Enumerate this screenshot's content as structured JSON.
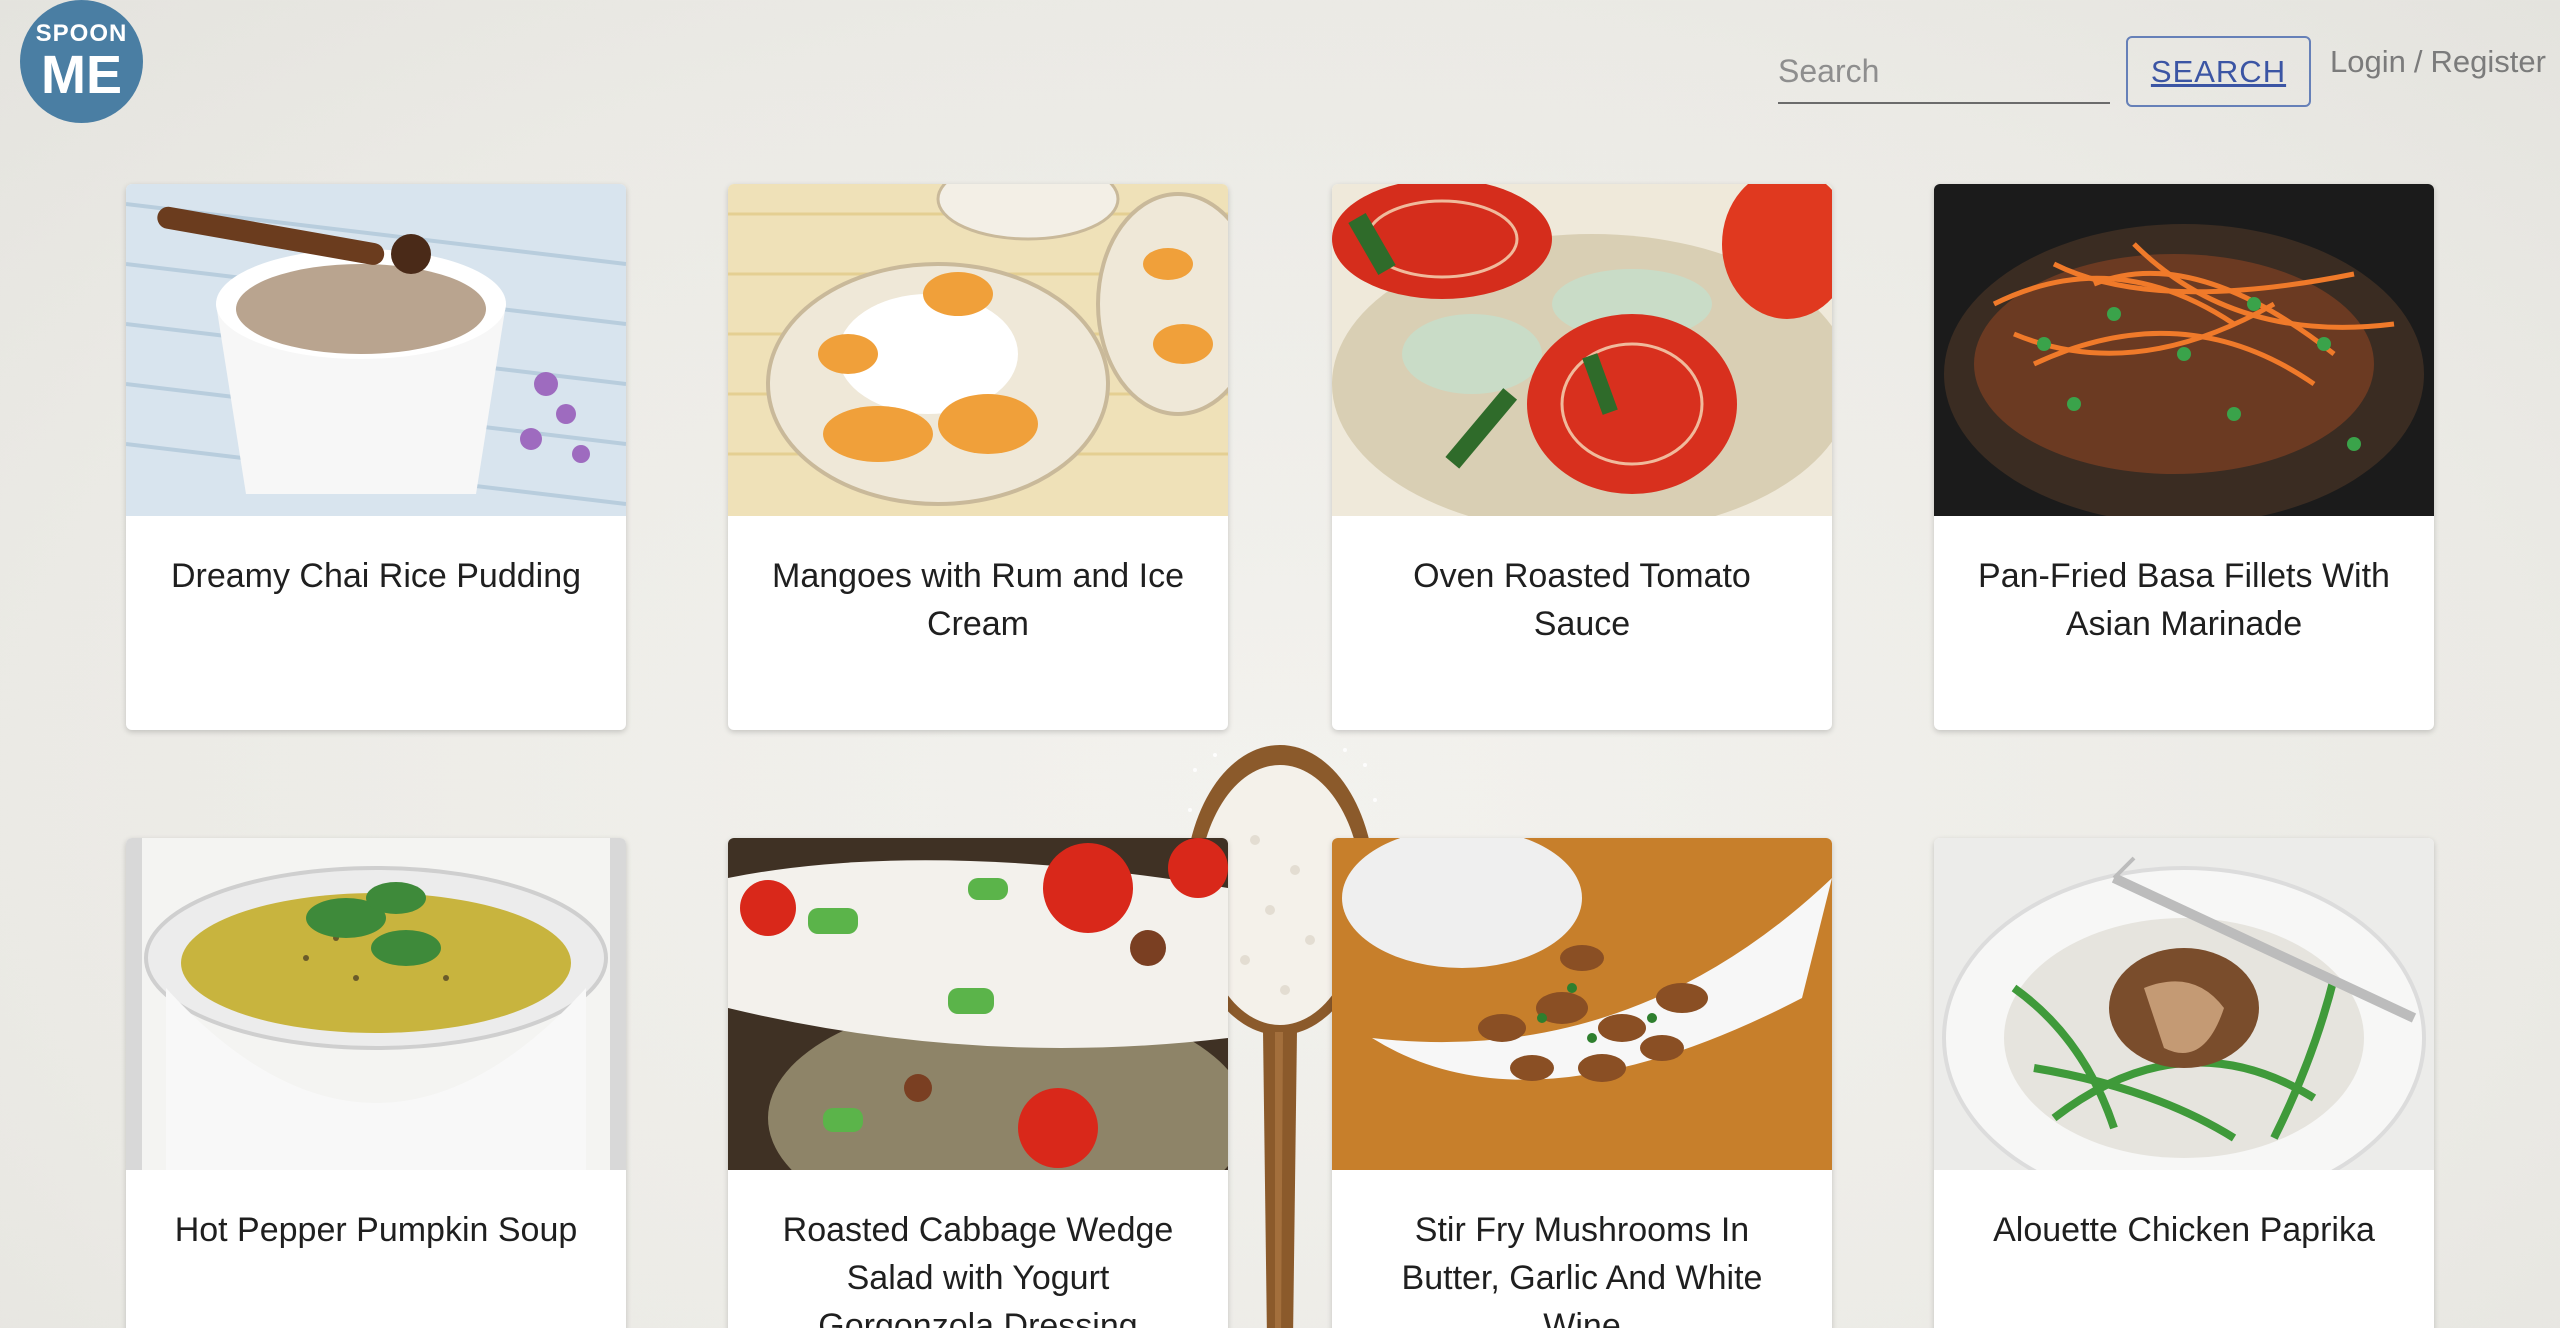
{
  "logo": {
    "line1": "SPOON",
    "line2": "ME"
  },
  "search": {
    "placeholder": "Search",
    "value": "",
    "button_label": "SEARCH"
  },
  "auth": {
    "login": "Login",
    "separator": "/",
    "register": "Register"
  },
  "colors": {
    "logo_bg": "#4a7ea3",
    "button_border": "#6680b8",
    "button_text": "#3b55a4"
  },
  "recipes": [
    {
      "title": "Dreamy Chai Rice Pudding"
    },
    {
      "title": "Mangoes with Rum and Ice Cream"
    },
    {
      "title": "Oven Roasted Tomato Sauce"
    },
    {
      "title": "Pan-Fried Basa Fillets With Asian Marinade"
    },
    {
      "title": "Hot Pepper Pumpkin Soup"
    },
    {
      "title": "Roasted Cabbage Wedge Salad with Yogurt Gorgonzola Dressing"
    },
    {
      "title": "Stir Fry Mushrooms In Butter, Garlic And White Wine"
    },
    {
      "title": "Alouette Chicken Paprika"
    }
  ]
}
